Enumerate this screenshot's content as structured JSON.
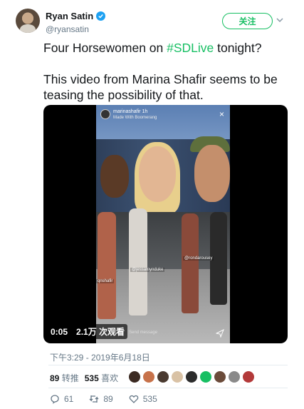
{
  "author": {
    "name": "Ryan Satin",
    "handle": "@ryansatin"
  },
  "follow_button": {
    "label": "关注"
  },
  "tweet": {
    "text_before_hashtag": "Four Horsewomen on ",
    "hashtag": "#SDLive",
    "text_after_hashtag": " tonight?",
    "paragraph2": "This video from Marina Shafir seems to be teasing the possibility of that."
  },
  "video": {
    "duration": "0:05",
    "views": "2.1万 次观看",
    "story": {
      "username": "marinashafir  1h",
      "subtitle": "Made With Boomerang",
      "tags": [
        "@jessamynduke",
        "@rondarousey",
        "qnshafir"
      ],
      "send_message": "Send message"
    }
  },
  "timestamp": "下午3:29 - 2019年6月18日",
  "stats": {
    "retweets_count": "89",
    "retweets_label": "转推",
    "likes_count": "535",
    "likes_label": "喜欢"
  },
  "liker_colors": [
    "#3b2a22",
    "#c7724a",
    "#4a3a30",
    "#d9c2a5",
    "#2c2c2c",
    "#17bf63",
    "#6b4b3a",
    "#8a8a8a",
    "#b33a3a"
  ],
  "actions": {
    "reply_count": "61",
    "retweet_count": "89",
    "like_count": "535"
  },
  "colors": {
    "accent_green": "#17bf63",
    "verified_blue": "#1da1f2",
    "secondary_text": "#657786"
  }
}
